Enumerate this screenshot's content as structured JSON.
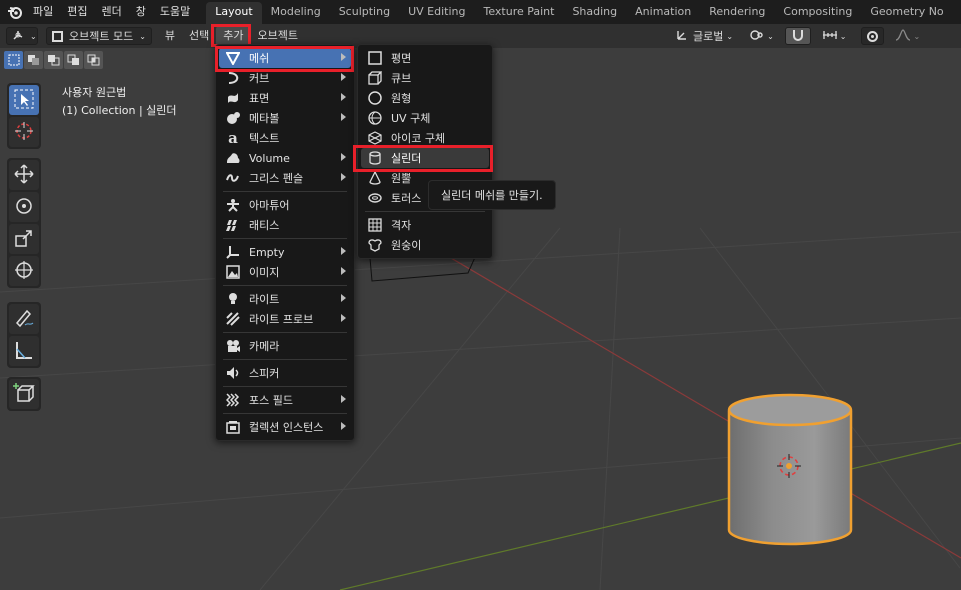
{
  "topbar": {
    "menus": [
      "파일",
      "편집",
      "렌더",
      "창",
      "도움말"
    ],
    "workspaces": [
      "Layout",
      "Modeling",
      "Sculpting",
      "UV Editing",
      "Texture Paint",
      "Shading",
      "Animation",
      "Rendering",
      "Compositing",
      "Geometry No"
    ],
    "active_workspace": "Layout"
  },
  "header": {
    "mode_label": "오브젝트 모드",
    "menus": {
      "view": "뷰",
      "select": "선택",
      "add": "추가",
      "object": "오브젝트"
    },
    "transform_orientation": "글로벌"
  },
  "viewport": {
    "view_name": "사용자 원근법",
    "collection": "(1) Collection | 실린더"
  },
  "add_menu": {
    "items": [
      {
        "label": "메쉬",
        "icon": "mesh-icon",
        "submenu": true
      },
      {
        "label": "커브",
        "icon": "curve-icon",
        "submenu": true
      },
      {
        "label": "표면",
        "icon": "surface-icon",
        "submenu": true
      },
      {
        "label": "메타볼",
        "icon": "metaball-icon",
        "submenu": true
      },
      {
        "label": "텍스트",
        "icon": "text-icon",
        "submenu": false
      },
      {
        "label": "Volume",
        "icon": "volume-icon",
        "submenu": true
      },
      {
        "label": "그리스 펜슬",
        "icon": "grease-pencil-icon",
        "submenu": true
      },
      {
        "label": "아마튜어",
        "icon": "armature-icon",
        "submenu": false
      },
      {
        "label": "래티스",
        "icon": "lattice-icon",
        "submenu": false
      },
      {
        "label": "Empty",
        "icon": "empty-icon",
        "submenu": true
      },
      {
        "label": "이미지",
        "icon": "image-icon",
        "submenu": true
      },
      {
        "label": "라이트",
        "icon": "light-icon",
        "submenu": true
      },
      {
        "label": "라이트 프로브",
        "icon": "light-probe-icon",
        "submenu": true
      },
      {
        "label": "카메라",
        "icon": "camera-icon",
        "submenu": false
      },
      {
        "label": "스피커",
        "icon": "speaker-icon",
        "submenu": false
      },
      {
        "label": "포스 필드",
        "icon": "force-field-icon",
        "submenu": true
      },
      {
        "label": "컬렉션 인스턴스",
        "icon": "collection-instance-icon",
        "submenu": true
      }
    ]
  },
  "mesh_menu": {
    "items": [
      {
        "label": "평면",
        "icon": "plane-icon"
      },
      {
        "label": "큐브",
        "icon": "cube-icon"
      },
      {
        "label": "원형",
        "icon": "circle-icon"
      },
      {
        "label": "UV 구체",
        "icon": "uv-sphere-icon"
      },
      {
        "label": "아이코 구체",
        "icon": "ico-sphere-icon"
      },
      {
        "label": "실린더",
        "icon": "cylinder-icon"
      },
      {
        "label": "원뿔",
        "icon": "cone-icon"
      },
      {
        "label": "토러스",
        "icon": "torus-icon"
      },
      {
        "label": "격자",
        "icon": "grid-icon"
      },
      {
        "label": "원숭이",
        "icon": "monkey-icon"
      }
    ]
  },
  "tooltip": {
    "text": "실린더 메쉬를 만들기."
  },
  "colors": {
    "highlight": "#4772b3",
    "annotation": "#e8202a",
    "selection": "#f0a030"
  }
}
